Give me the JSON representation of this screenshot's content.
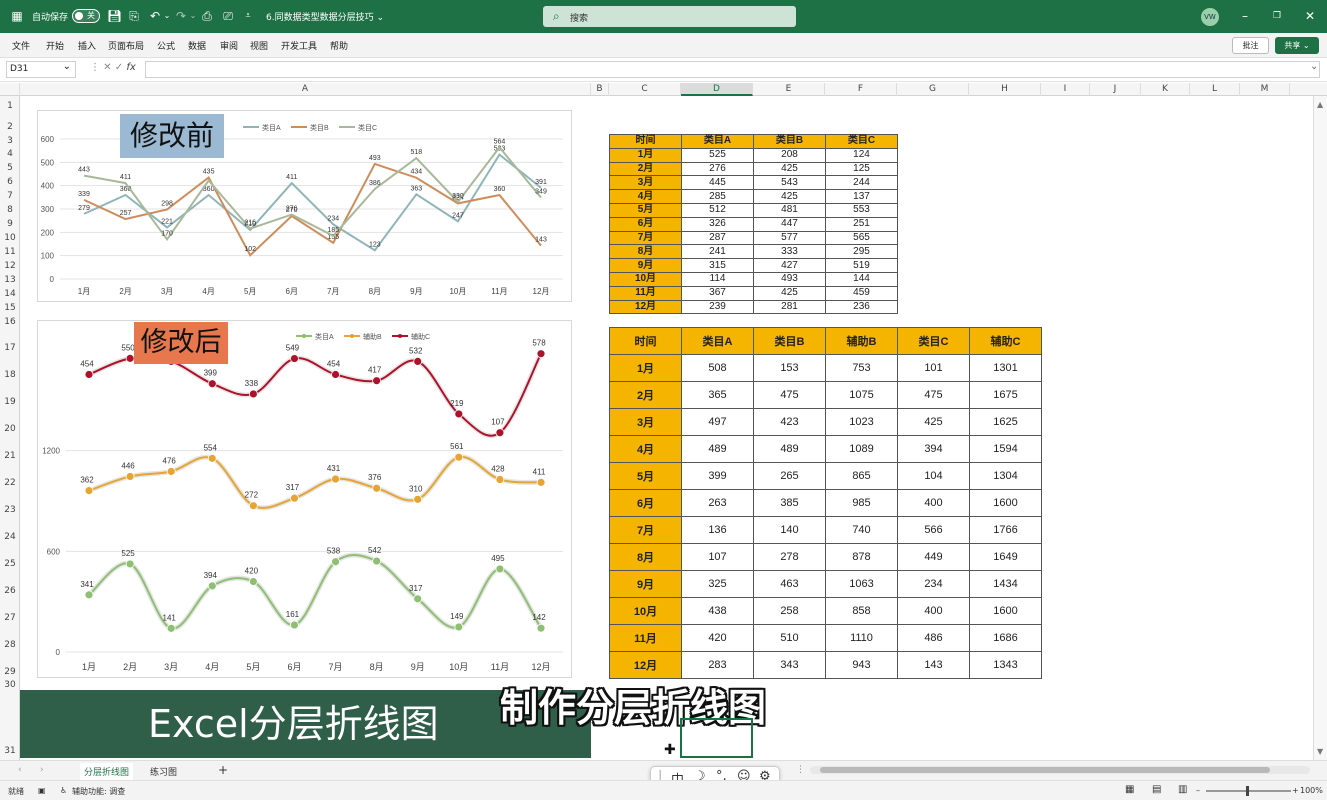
{
  "titlebar": {
    "autosave_label": "自动保存",
    "autosave_state": "关",
    "doc_title": "6.同数据类型数据分层技巧 ⌄",
    "search_placeholder": "搜索",
    "user_initials": "VW"
  },
  "menu": [
    "文件",
    "开始",
    "插入",
    "页面布局",
    "公式",
    "数据",
    "审阅",
    "视图",
    "开发工具",
    "帮助"
  ],
  "menu_right": {
    "comment": "批注",
    "share": "共享 ⌄"
  },
  "formula": {
    "name_box": "D31",
    "fx": "fx"
  },
  "columns": [
    "A",
    "B",
    "C",
    "D",
    "E",
    "F",
    "G",
    "H",
    "I",
    "J",
    "K",
    "L",
    "M"
  ],
  "selected_column": "D",
  "rows": [
    "1",
    "2",
    "3",
    "4",
    "5",
    "6",
    "7",
    "8",
    "9",
    "10",
    "11",
    "12",
    "13",
    "14",
    "15",
    "16",
    "17",
    "18",
    "19",
    "20",
    "21",
    "22",
    "23",
    "24",
    "25",
    "26",
    "27",
    "28",
    "29",
    "30",
    "31"
  ],
  "chart_data": [
    {
      "type": "line",
      "title": "修改前",
      "categories": [
        "1月",
        "2月",
        "3月",
        "4月",
        "5月",
        "6月",
        "7月",
        "8月",
        "9月",
        "10月",
        "11月",
        "12月"
      ],
      "yticks": [
        "0",
        "100",
        "200",
        "300",
        "400",
        "500",
        "600"
      ],
      "ylim": [
        0,
        600
      ],
      "legend_position": "top",
      "series": [
        {
          "name": "类目A",
          "color": "#8fb5b9",
          "values": [
            279,
            360,
            221,
            360,
            210,
            411,
            234,
            123,
            363,
            247,
            533,
            391
          ],
          "labels": [
            "279",
            "360",
            "221",
            "360",
            "210",
            "411",
            "234",
            "123",
            "363",
            "247",
            "533",
            "391"
          ]
        },
        {
          "name": "类目B",
          "color": "#cf8c5b",
          "values": [
            339,
            257,
            298,
            435,
            102,
            270,
            155,
            493,
            434,
            324,
            360,
            143
          ],
          "labels": [
            "339",
            "257",
            "298",
            "435",
            "102",
            "270",
            "155",
            "493",
            "434",
            "324",
            "360",
            "143"
          ]
        },
        {
          "name": "类目C",
          "color": "#a8b99a",
          "values": [
            443,
            411,
            170,
            422,
            216,
            276,
            185,
            386,
            518,
            330,
            564,
            349
          ],
          "labels": [
            "443",
            "411",
            "170",
            "",
            "216",
            "276",
            "185",
            "386",
            "518",
            "330",
            "564",
            "349"
          ]
        }
      ]
    },
    {
      "type": "line",
      "title": "修改后",
      "categories": [
        "1月",
        "2月",
        "3月",
        "4月",
        "5月",
        "6月",
        "7月",
        "8月",
        "9月",
        "10月",
        "11月",
        "12月"
      ],
      "yticks": [
        "0",
        "600",
        "1200"
      ],
      "ylim": [
        0,
        1800
      ],
      "legend_position": "top",
      "series": [
        {
          "name": "类目A",
          "color": "#8fbf72",
          "values": [
            341,
            525,
            141,
            394,
            420,
            161,
            538,
            542,
            317,
            149,
            495,
            142
          ]
        },
        {
          "name": "辅助B",
          "color": "#e6a531",
          "values": [
            962,
            1046,
            1076,
            1154,
            872,
            917,
            1031,
            976,
            910,
            1161,
            1028,
            1011
          ],
          "labels": [
            "362",
            "446",
            "476",
            "554",
            "272",
            "317",
            "431",
            "376",
            "310",
            "561",
            "428",
            "411"
          ]
        },
        {
          "name": "辅助C",
          "color": "#b0112a",
          "values": [
            1654,
            1750,
            1732,
            1599,
            1538,
            1749,
            1654,
            1617,
            1732,
            1419,
            1307,
            1778
          ],
          "labels": [
            "454",
            "550",
            "532",
            "399",
            "338",
            "549",
            "454",
            "417",
            "532",
            "219",
            "107",
            "578"
          ]
        }
      ]
    }
  ],
  "table1": {
    "headers": [
      "时间",
      "类目A",
      "类目B",
      "类目C"
    ],
    "rows": [
      [
        "1月",
        "525",
        "208",
        "124"
      ],
      [
        "2月",
        "276",
        "425",
        "125"
      ],
      [
        "3月",
        "445",
        "543",
        "244"
      ],
      [
        "4月",
        "285",
        "425",
        "137"
      ],
      [
        "5月",
        "512",
        "481",
        "553"
      ],
      [
        "6月",
        "326",
        "447",
        "251"
      ],
      [
        "7月",
        "287",
        "577",
        "565"
      ],
      [
        "8月",
        "241",
        "333",
        "295"
      ],
      [
        "9月",
        "315",
        "427",
        "519"
      ],
      [
        "10月",
        "114",
        "493",
        "144"
      ],
      [
        "11月",
        "367",
        "425",
        "459"
      ],
      [
        "12月",
        "239",
        "281",
        "236"
      ]
    ]
  },
  "table2": {
    "headers": [
      "时间",
      "类目A",
      "类目B",
      "辅助B",
      "类目C",
      "辅助C"
    ],
    "rows": [
      [
        "1月",
        "508",
        "153",
        "753",
        "101",
        "1301"
      ],
      [
        "2月",
        "365",
        "475",
        "1075",
        "475",
        "1675"
      ],
      [
        "3月",
        "497",
        "423",
        "1023",
        "425",
        "1625"
      ],
      [
        "4月",
        "489",
        "489",
        "1089",
        "394",
        "1594"
      ],
      [
        "5月",
        "399",
        "265",
        "865",
        "104",
        "1304"
      ],
      [
        "6月",
        "263",
        "385",
        "985",
        "400",
        "1600"
      ],
      [
        "7月",
        "136",
        "140",
        "740",
        "566",
        "1766"
      ],
      [
        "8月",
        "107",
        "278",
        "878",
        "449",
        "1649"
      ],
      [
        "9月",
        "325",
        "463",
        "1063",
        "234",
        "1434"
      ],
      [
        "10月",
        "438",
        "258",
        "858",
        "400",
        "1600"
      ],
      [
        "11月",
        "420",
        "510",
        "1110",
        "486",
        "1686"
      ],
      [
        "12月",
        "283",
        "343",
        "943",
        "143",
        "1343"
      ]
    ]
  },
  "banner_text": "Excel分层折线图",
  "caption_text": "制作分层折线图",
  "sheet_tabs": {
    "active": "分层折线图",
    "other": "练习图"
  },
  "status": {
    "ready": "就绪",
    "accessibility": "辅助功能: 调查",
    "zoom": "100%"
  }
}
